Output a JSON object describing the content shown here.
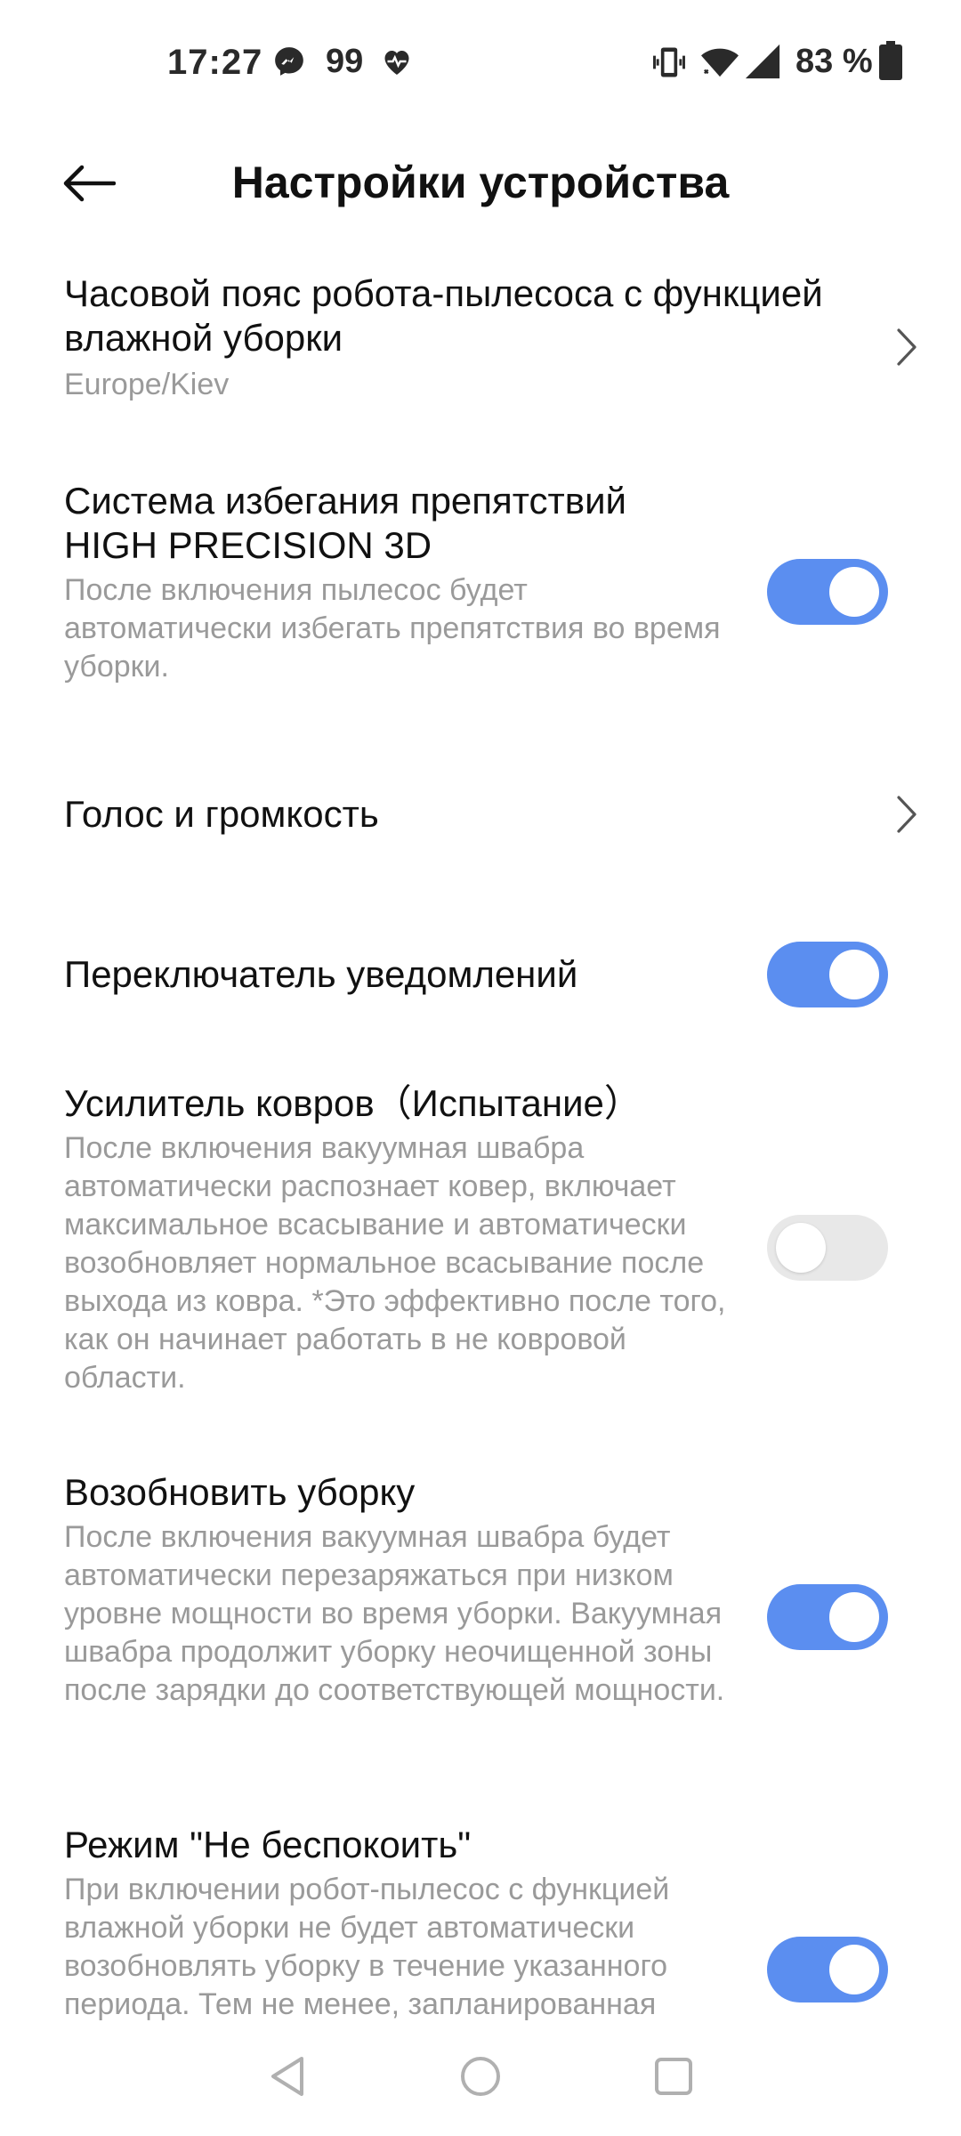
{
  "status_bar": {
    "time": "17:27",
    "notification_count": "99",
    "battery": "83 %",
    "icons": [
      "messenger-icon",
      "heart-pulse-icon",
      "vibrate-icon",
      "wifi-icon",
      "signal-icon",
      "battery-icon"
    ]
  },
  "header": {
    "title": "Настройки устройства",
    "back_icon": "arrow-left-icon"
  },
  "settings": {
    "timezone": {
      "title": "Часовой пояс робота-пылесоса с функцией влажной уборки",
      "value": "Europe/Kiev"
    },
    "obstacle_avoidance": {
      "title_line1": "Система избегания препятствий",
      "title_line2": "HIGH PRECISION 3D",
      "description": "После включения пылесос будет автоматически избегать препятствия во время уборки.",
      "enabled": true
    },
    "voice": {
      "title": "Голос и громкость"
    },
    "notifications": {
      "title": "Переключатель уведомлений",
      "enabled": true
    },
    "carpet_boost": {
      "title": "Усилитель ковров（Испытание）",
      "description": "После включения вакуумная швабра автоматически распознает ковер, включает максимальное всасывание и автоматически возобновляет нормальное всасывание после выхода из ковра. *Это эффективно после того, как он начинает работать в не ковровой области.",
      "enabled": false
    },
    "resume_cleaning": {
      "title": "Возобновить уборку",
      "description": "После включения вакуумная швабра будет автоматически перезаряжаться при низком уровне мощности во время уборки. Вакуумная швабра продолжит уборку неочищенной зоны после зарядки до соответствующей мощности.",
      "enabled": true
    },
    "dnd": {
      "title": "Режим \"Не беспокоить\"",
      "description": "При включении робот-пылесос с функцией влажной уборки не будет автоматически возобновлять уборку в течение указанного периода. Тем не менее, запланированная",
      "enabled": true
    }
  },
  "nav_bar": {
    "icons": [
      "nav-back-icon",
      "nav-home-icon",
      "nav-recents-icon"
    ]
  },
  "colors": {
    "accent": "#5b8ef0",
    "toggle_off": "#e8e8e8",
    "secondary_text": "#9a9a9a"
  }
}
